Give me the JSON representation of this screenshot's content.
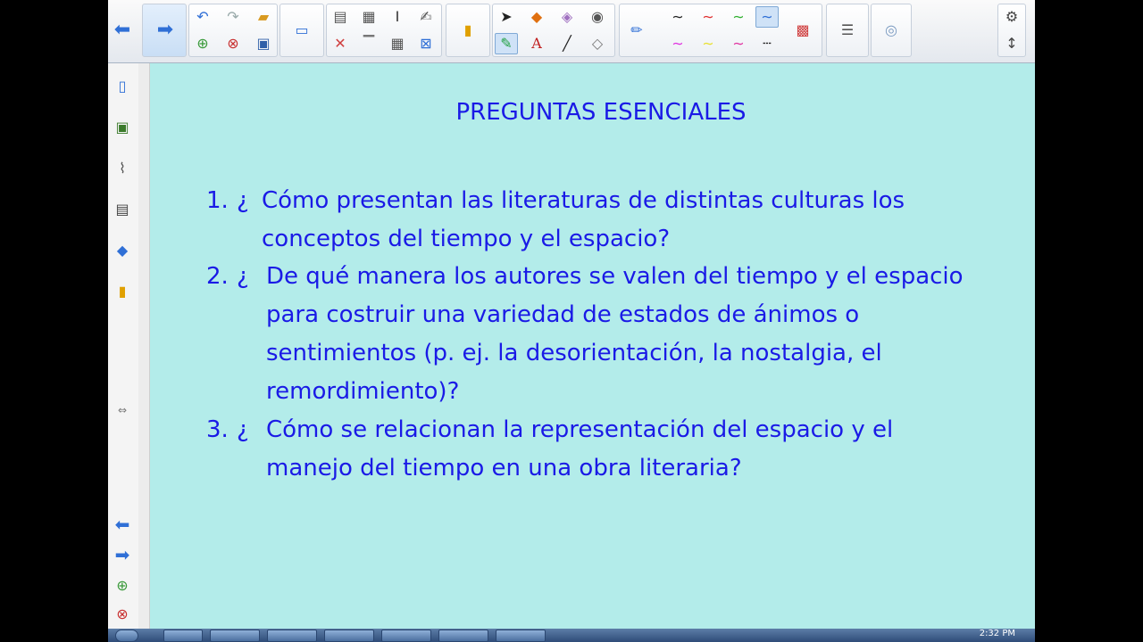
{
  "toolbar": {
    "undo_icon": "↶",
    "redo_icon": "↷",
    "accent": "#2f6fd6"
  },
  "slide": {
    "title": "PREGUNTAS ESENCIALES",
    "questions": [
      {
        "num": "1.",
        "inv": "¿",
        "text": "Cómo presentan las literaturas de distintas culturas los\nconceptos del tiempo y el espacio?"
      },
      {
        "num": "2.",
        "inv": "¿",
        "text": "De qué manera los autores se valen del tiempo y el espacio\npara costruir una variedad de estados de ánimos o\nsentimientos (p. ej. la desorientación, la nostalgia, el\nremordimiento)?"
      },
      {
        "num": "3.",
        "inv": "¿",
        "text": "Cómo se relacionan la representación del espacio y el\nmanejo del tiempo en una obra literaria?"
      }
    ],
    "text_color": "#1a1ae6",
    "background": "#b3ecea"
  },
  "taskbar": {
    "clock": "2:32 PM"
  }
}
